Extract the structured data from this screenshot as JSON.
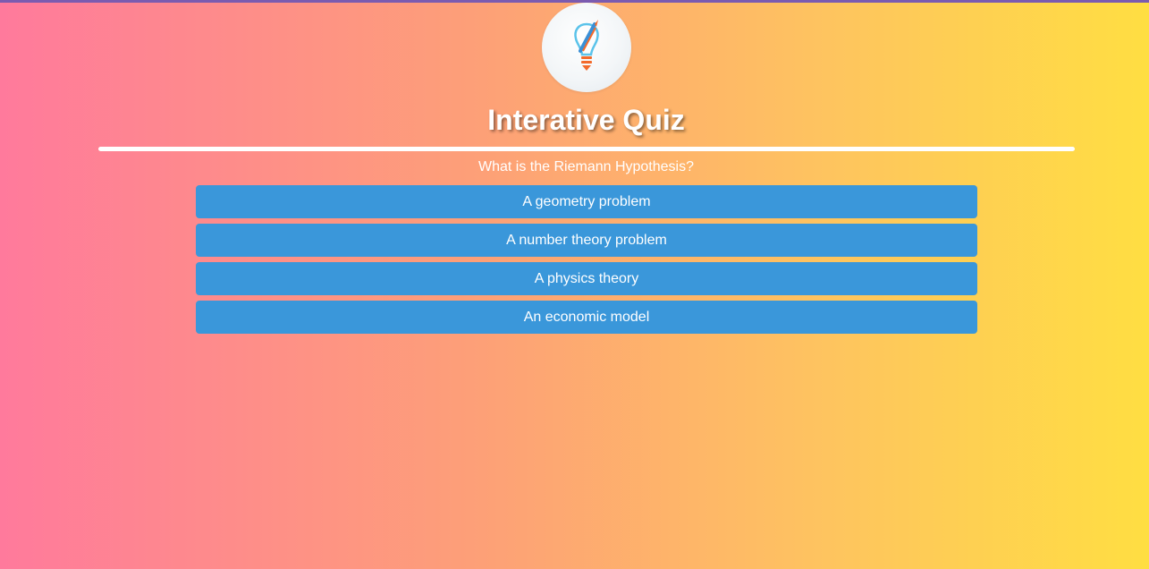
{
  "header": {
    "logo_icon": "lightbulb-pencil-icon",
    "title": "Interative Quiz"
  },
  "quiz": {
    "question": "What is the Riemann Hypothesis?",
    "answers": [
      "A geometry problem",
      "A number theory problem",
      "A physics theory",
      "An economic model"
    ]
  },
  "colors": {
    "gradient_left": "#ff7a9c",
    "gradient_right": "#ffde42",
    "button": "#3a97da",
    "text": "#ffffff",
    "top_bar": "#7b5bb0"
  }
}
